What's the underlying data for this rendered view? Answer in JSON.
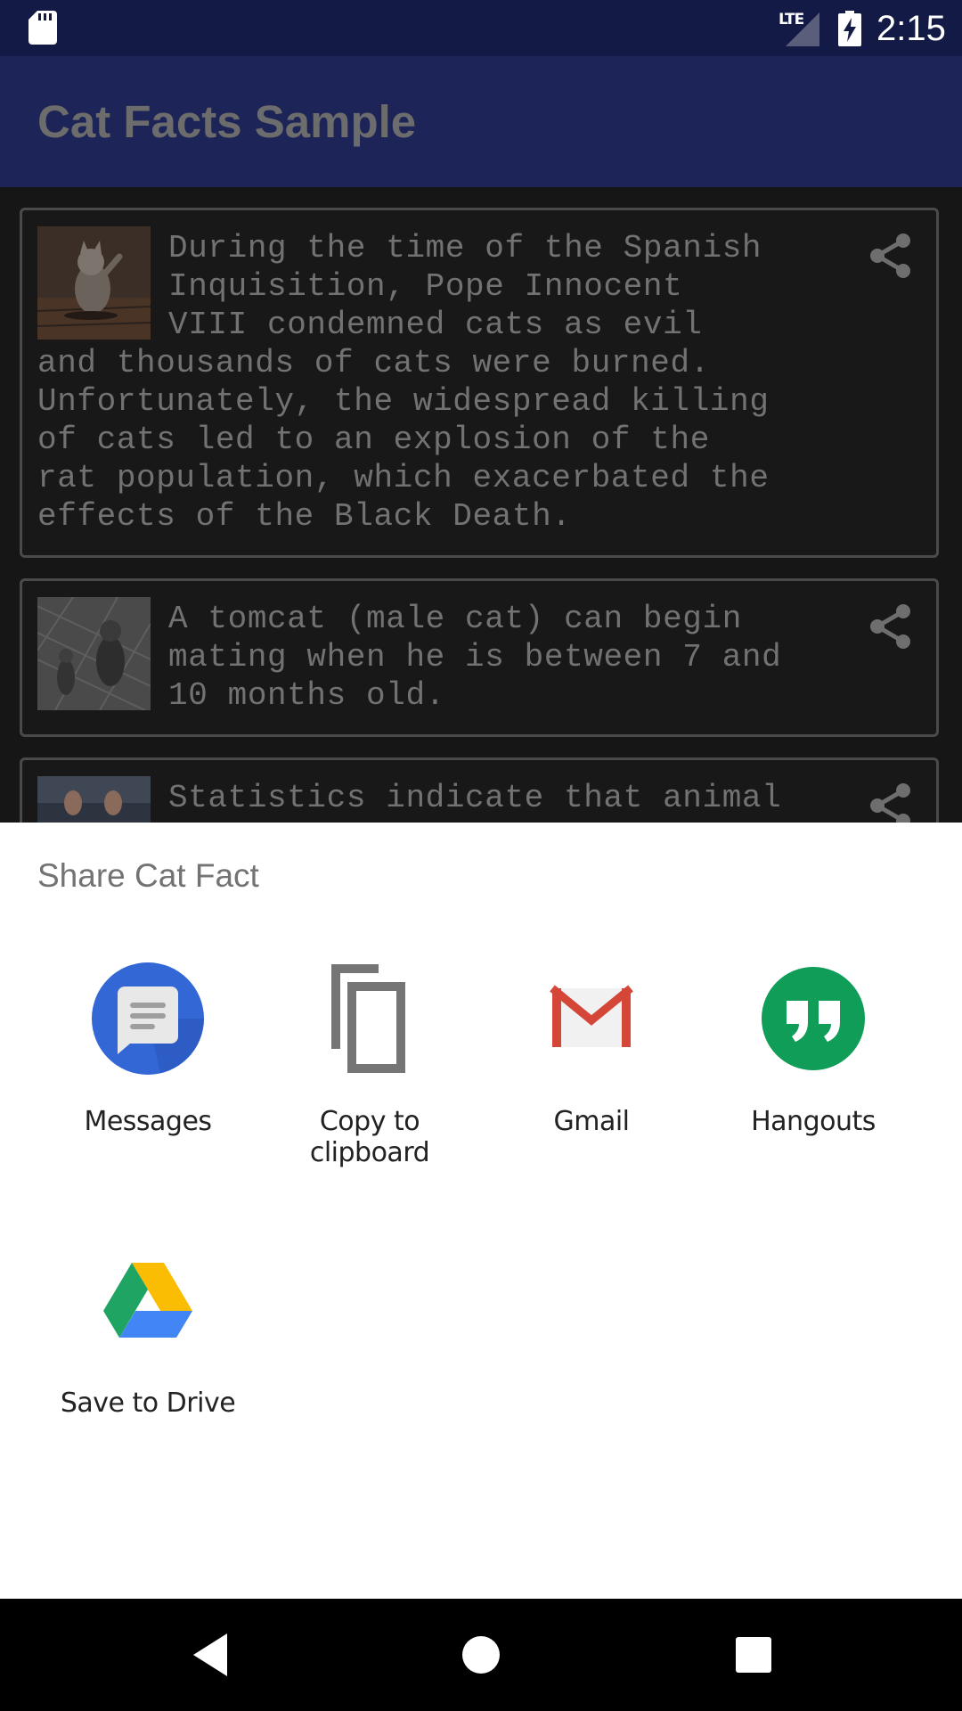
{
  "status_bar": {
    "network": "LTE",
    "time": "2:15",
    "icons": [
      "sd-card-icon",
      "signal-icon",
      "battery-charging-icon"
    ]
  },
  "app_bar": {
    "title": "Cat Facts Sample",
    "color": "#1d2457"
  },
  "facts": [
    {
      "text": "During the time of the Spanish Inquisition, Pope Innocent VIII condemned cats as evil and thousands of cats were burned. Unfortunately, the widespread killing of cats led to an explosion of the rat population, which exacerbated the effects of the Black Death.",
      "lines": [
        "During the time of the Spanish",
        "Inquisition, Pope Innocent",
        "VIII condemned cats as evil",
        "and thousands of cats were burned.",
        "Unfortunately, the widespread killing",
        "of cats led to an explosion of the",
        "rat population, which exacerbated the",
        "effects of the Black Death."
      ],
      "share_icon": "share-icon"
    },
    {
      "text": "A tomcat (male cat) can begin mating when he is between 7 and 10 months old.",
      "lines": [
        "A tomcat (male cat) can begin",
        "mating when he is between 7 and",
        "10 months old."
      ],
      "share_icon": "share-icon"
    },
    {
      "text": "Statistics indicate that animal",
      "lines": [
        "Statistics indicate that animal"
      ],
      "share_icon": "share-icon"
    }
  ],
  "share_sheet": {
    "title": "Share Cat Fact",
    "targets": [
      {
        "label": "Messages",
        "icon": "messages-icon",
        "color": "#3367d6"
      },
      {
        "label": "Copy to clipboard",
        "icon": "copy-icon",
        "color": "#757575"
      },
      {
        "label": "Gmail",
        "icon": "gmail-icon",
        "color": "#d44638"
      },
      {
        "label": "Hangouts",
        "icon": "hangouts-icon",
        "color": "#0f9d58"
      },
      {
        "label": "Save to Drive",
        "icon": "drive-icon",
        "color": "#1fa463"
      }
    ]
  },
  "nav_bar": {
    "buttons": [
      "back-icon",
      "home-icon",
      "recents-icon"
    ]
  }
}
